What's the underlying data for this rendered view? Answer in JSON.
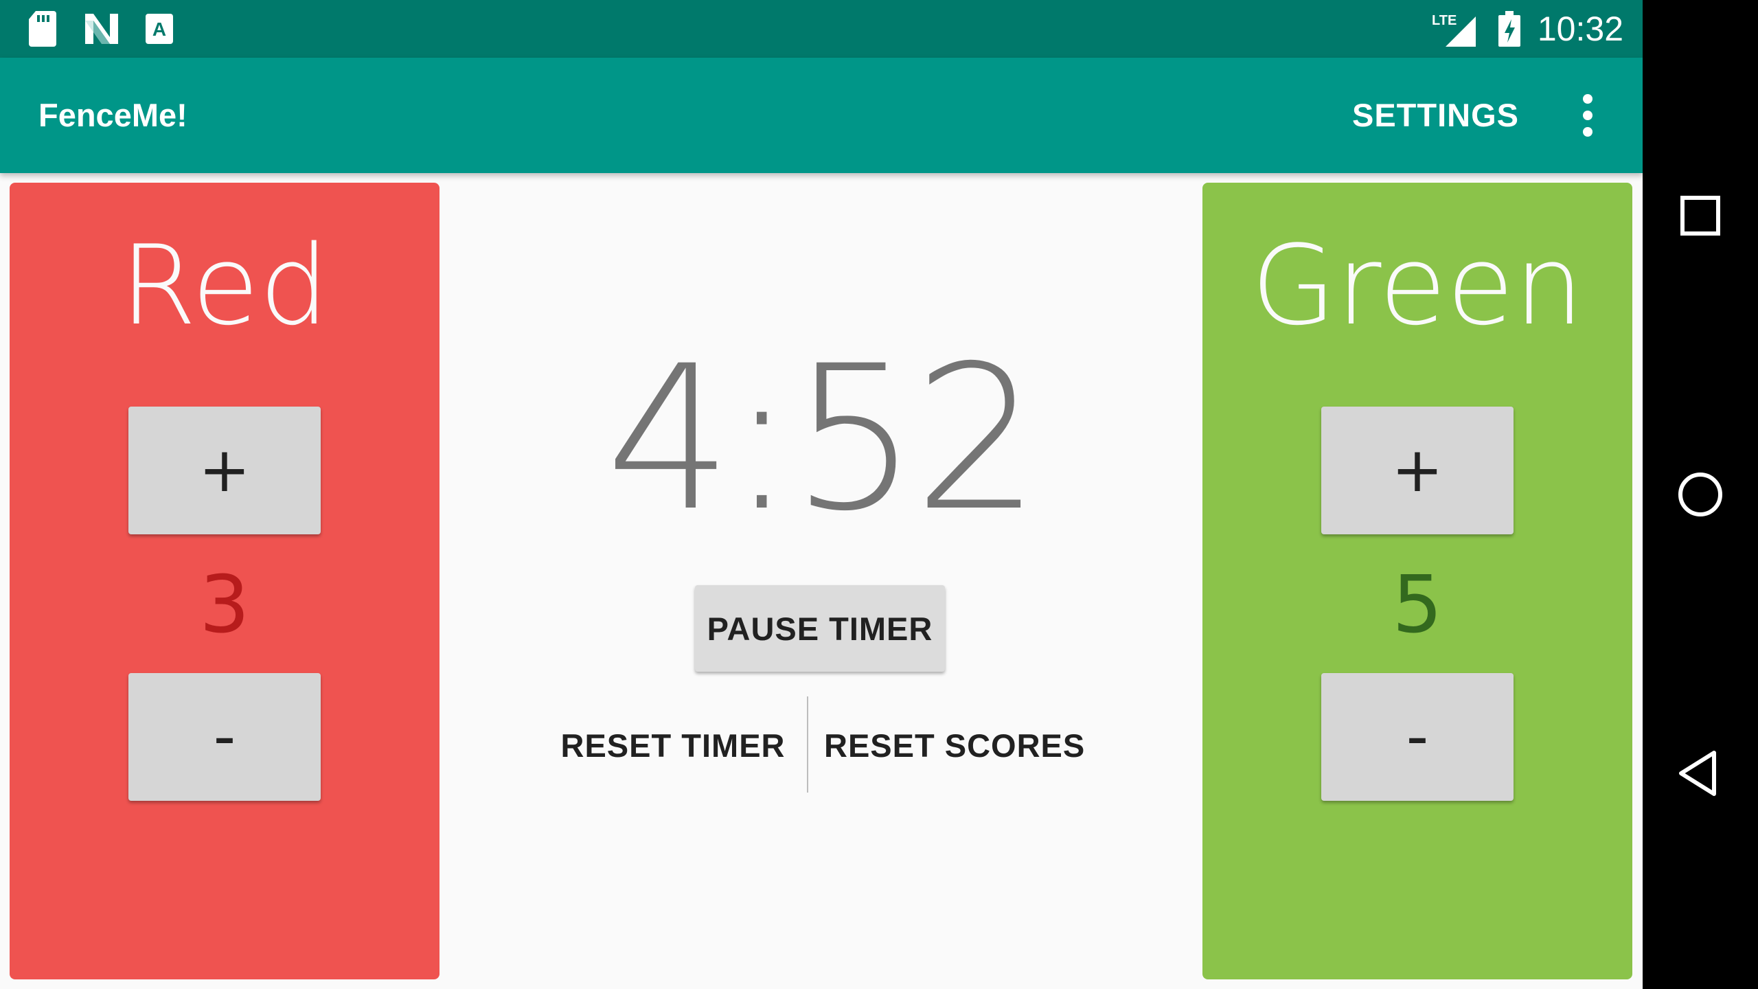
{
  "status_bar": {
    "time": "10:32",
    "network_label": "LTE",
    "icons": [
      "sd-card-icon",
      "n-logo-icon",
      "text-a-icon",
      "lte-signal-icon",
      "battery-charging-icon"
    ]
  },
  "app_bar": {
    "title": "FenceMe!",
    "settings_label": "SETTINGS",
    "overflow_icon": "more-vert-icon"
  },
  "red": {
    "name": "Red",
    "plus_label": "+",
    "minus_label": "-",
    "score": "3",
    "color": "#ef5350"
  },
  "green": {
    "name": "Green",
    "plus_label": "+",
    "minus_label": "-",
    "score": "5",
    "color": "#8bc34a"
  },
  "timer": {
    "display": "4:52",
    "pause_label": "PAUSE TIMER",
    "reset_timer_label": "RESET TIMER",
    "reset_scores_label": "RESET SCORES"
  },
  "nav_bar": {
    "icons": [
      "recents-square-icon",
      "home-circle-icon",
      "back-triangle-icon"
    ]
  },
  "colors": {
    "status_bar": "#00796b",
    "app_bar": "#009688",
    "background": "#fafafa"
  }
}
